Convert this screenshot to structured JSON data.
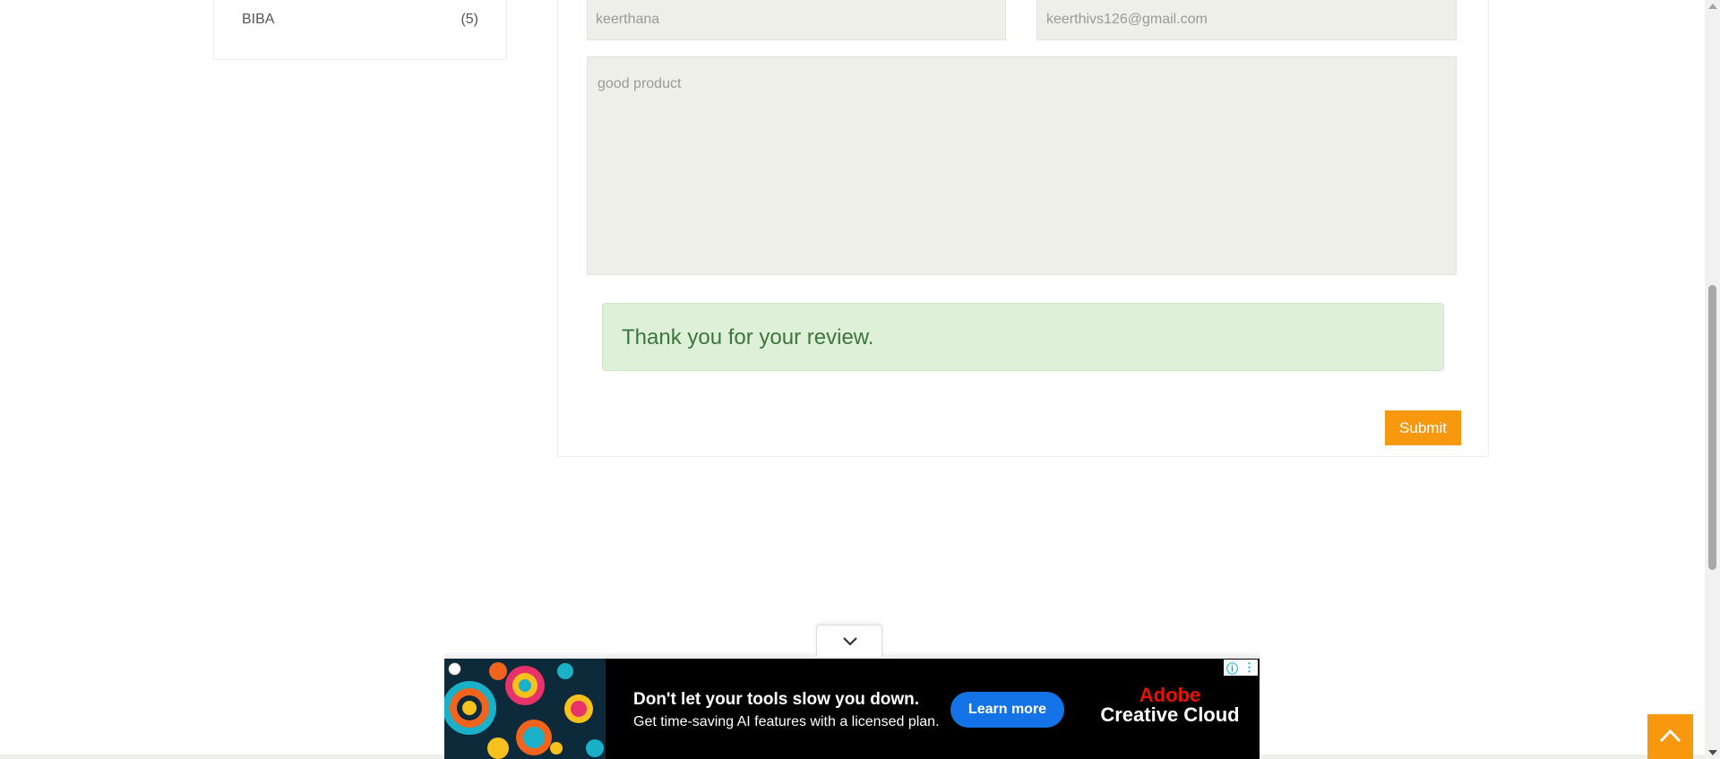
{
  "sidebar": {
    "brand_filter": {
      "label": "BIBA",
      "count": "(5)"
    }
  },
  "review_form": {
    "name_value": "keerthana",
    "email_value": "keerthivs126@gmail.com",
    "review_value": "good product",
    "success_message": "Thank you for your review.",
    "submit_label": "Submit"
  },
  "ad": {
    "headline": "Don't let your tools slow you down.",
    "subline": "Get time-saving AI features with a licensed plan.",
    "cta_label": "Learn more",
    "brand_line1": "Adobe",
    "brand_line2": "Creative Cloud",
    "info_glyph": "ⓘ",
    "menu_glyph": "⋮"
  },
  "colors": {
    "accent": "#f7980f",
    "success_bg": "#dff0d8",
    "success_text": "#3c763d",
    "field_bg": "#efefe9",
    "ad_cta": "#1473e6",
    "adobe_red": "#eb1000"
  },
  "icons": {
    "collapse": "chevron-down-icon",
    "back_to_top": "chevron-up-icon",
    "ad_info": "info-icon",
    "ad_menu": "kebab-menu-icon",
    "ad_privacy": "privacy-icon"
  }
}
